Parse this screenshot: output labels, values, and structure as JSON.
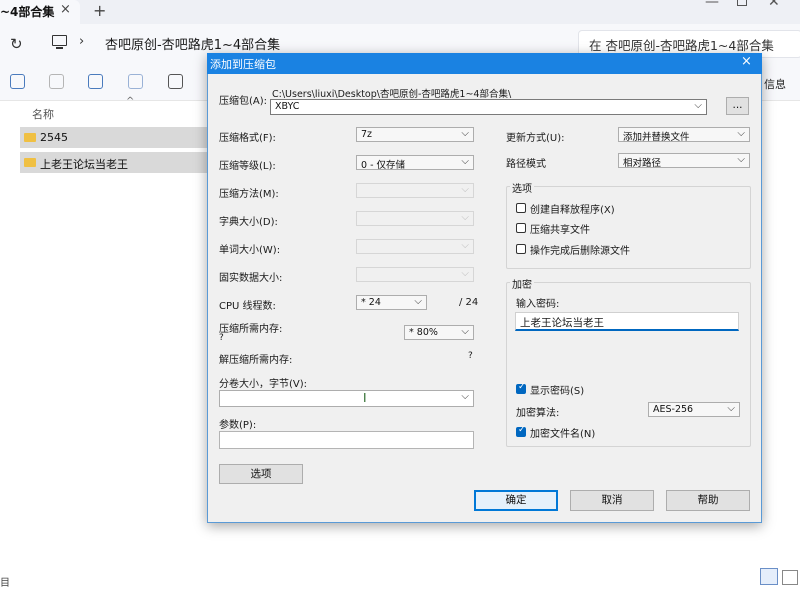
{
  "explorer": {
    "tab_title": "~4部合集",
    "tab_close": "×",
    "new_tab": "+",
    "breadcrumb": "杏吧原创-杏吧路虎1~4部合集",
    "search_placeholder": "在 杏吧原创-杏吧路虎1~4部合集",
    "toolbar_info_tail": "信息",
    "column_name": "名称",
    "items": [
      {
        "name": "2545"
      },
      {
        "name": "上老王论坛当老王"
      }
    ],
    "status_left": "目"
  },
  "dialog": {
    "title": "添加到压缩包",
    "close": "×",
    "archive_label": "压缩包(A):",
    "archive_path": "C:\\Users\\liuxi\\Desktop\\杏吧原创-杏吧路虎1~4部合集\\",
    "archive_name": "XBYC",
    "browse_label": "...",
    "left": {
      "format_label": "压缩格式(F):",
      "format_value": "7z",
      "level_label": "压缩等级(L):",
      "level_value": "0 - 仅存储",
      "method_label": "压缩方法(M):",
      "dict_label": "字典大小(D):",
      "word_label": "单词大小(W):",
      "solid_label": "固实数据大小:",
      "cpu_label": "CPU 线程数:",
      "cpu_value": "* 24",
      "cpu_total": "/ 24",
      "mem_label": "压缩所需内存:",
      "mem_question": "?",
      "mem_value": "* 80%",
      "decomp_label": "解压缩所需内存:",
      "decomp_question": "?",
      "split_label": "分卷大小，字节(V):",
      "params_label": "参数(P):",
      "options_button": "选项"
    },
    "right": {
      "update_label": "更新方式(U):",
      "update_value": "添加并替换文件",
      "path_label": "路径模式",
      "path_value": "相对路径",
      "options_group": "选项",
      "opt_sfx": "创建自释放程序(X)",
      "opt_shared": "压缩共享文件",
      "opt_delete": "操作完成后删除源文件",
      "encrypt_group": "加密",
      "password_label": "输入密码:",
      "password_value": "上老王论坛当老王",
      "show_password": "显示密码(S)",
      "method_label": "加密算法:",
      "method_value": "AES-256",
      "encrypt_names": "加密文件名(N)"
    },
    "ok": "确定",
    "cancel": "取消",
    "help": "帮助"
  }
}
